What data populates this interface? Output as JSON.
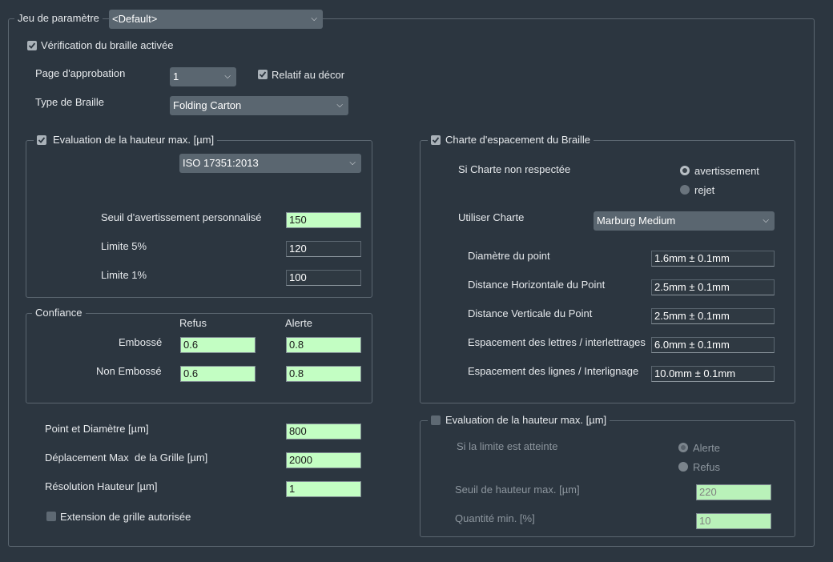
{
  "parameter_set": {
    "label": "Jeu de paramètre",
    "value": "<Default>"
  },
  "braille_check": {
    "label": "Vérification du braille activée",
    "checked": true
  },
  "approval_page": {
    "label": "Page d'approbation",
    "value": "1"
  },
  "relative_to_decor": {
    "label": "Relatif au décor",
    "checked": true
  },
  "braille_type": {
    "label": "Type de Braille",
    "value": "Folding Carton"
  },
  "height_eval": {
    "label": "Evaluation de la hauteur max. [µm]",
    "checked": true,
    "standard": "ISO 17351:2013",
    "custom_warning": {
      "label": "Seuil d'avertissement personnalisé",
      "value": "150"
    },
    "limit5": {
      "label": "Limite 5%",
      "value": "120"
    },
    "limit1": {
      "label": "Limite 1%",
      "value": "100"
    }
  },
  "confidence": {
    "label": "Confiance",
    "col_refus": "Refus",
    "col_alerte": "Alerte",
    "embossed": {
      "label": "Embossé",
      "refus": "0.6",
      "alerte": "0.8"
    },
    "non_embossed": {
      "label": "Non Embossé",
      "refus": "0.6",
      "alerte": "0.8"
    }
  },
  "point_diameter": {
    "label": "Point et Diamètre [µm]",
    "value": "800"
  },
  "grid_max_shift": {
    "label": "Déplacement Max  de la Grille [µm]",
    "value": "2000"
  },
  "height_resolution": {
    "label": "Résolution Hauteur [µm]",
    "value": "1"
  },
  "grid_extension": {
    "label": "Extension de grille autorisée",
    "checked": false
  },
  "spacing_chart": {
    "label": "Charte d'espacement du Braille",
    "checked": true,
    "if_not_respected": "Si Charte non respectée",
    "opt_warning": "avertissement",
    "opt_reject": "rejet",
    "selected": "avertissement",
    "use_chart": {
      "label": "Utiliser Charte",
      "value": "Marburg Medium"
    },
    "rows": [
      {
        "label": "Diamètre du point",
        "value": "1.6mm ± 0.1mm"
      },
      {
        "label": "Distance Horizontale du Point",
        "value": "2.5mm ± 0.1mm"
      },
      {
        "label": "Distance Verticale du Point",
        "value": "2.5mm ± 0.1mm"
      },
      {
        "label": "Espacement des lettres / interlettrages",
        "value": "6.0mm ± 0.1mm"
      },
      {
        "label": "Espacement des lignes / Interlignage",
        "value": "10.0mm ± 0.1mm"
      }
    ]
  },
  "height_eval2": {
    "label": "Evaluation de la hauteur max. [µm]",
    "checked": false,
    "limit_reached": "Si la limite est atteinte",
    "opt_alert": "Alerte",
    "opt_refus": "Refus",
    "selected": "Alerte",
    "max_height": {
      "label": "Seuil de hauteur max. [µm]",
      "value": "220"
    },
    "min_qty": {
      "label": "Quantité min. [%]",
      "value": "10"
    }
  },
  "colors": {
    "background": "#2c3640",
    "input_green": "#c3fec3",
    "combo": "#5a6670"
  }
}
